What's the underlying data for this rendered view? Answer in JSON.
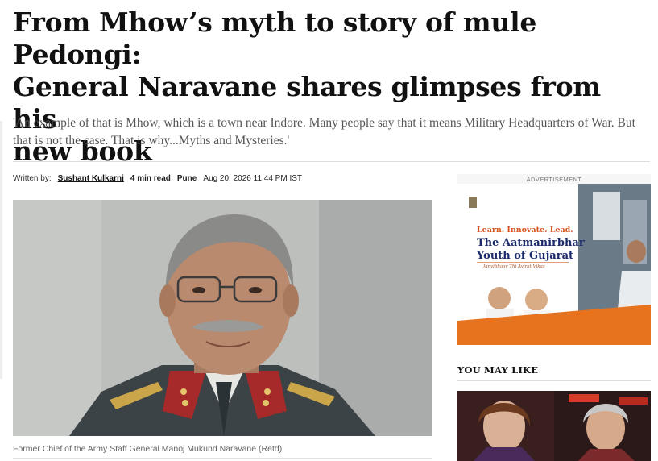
{
  "article": {
    "headline_lines": [
      "From Mhow’s myth to story of mule Pedongi:",
      "General Naravane shares glimpses from his",
      "new book"
    ],
    "standfirst": "'An example of that is Mhow, which is a town near Indore. Many people say that it means Military Headquarters of War. But that is not the case. That is why...Myths and Mysteries.'",
    "byline": {
      "written_by_label": "Written by:",
      "author": "Sushant Kulkarni",
      "read_time": "4 min read",
      "city": "Pune",
      "timestamp": "Aug 20, 2026 11:44 PM IST"
    },
    "image_caption": "Former Chief of the Army Staff General Manoj Mukund Naravane (Retd)"
  },
  "sidebar": {
    "ad_label": "ADVERTISEMENT",
    "ad": {
      "tagline": "Learn. Innovate. Lead.",
      "title_line1": "The Aatmanirbhar",
      "title_line2": "Youth of Gujarat",
      "subtitle": "Janvibhaav Thi Avirat Vikas"
    },
    "you_may_like_title": "YOU MAY LIKE"
  },
  "colors": {
    "headline": "#111111",
    "standfirst": "#555555",
    "ad_orange": "#e8731f",
    "ad_navy": "#1b2a6b"
  }
}
